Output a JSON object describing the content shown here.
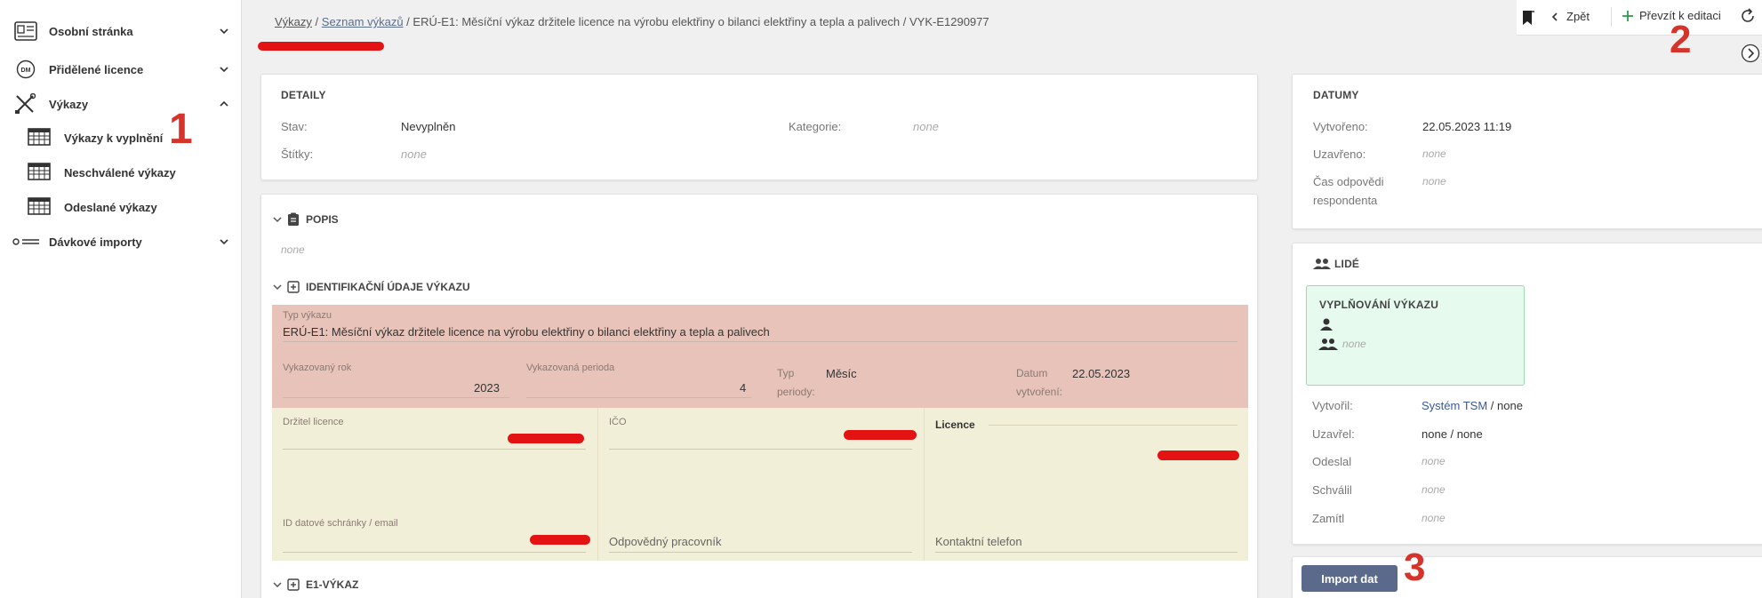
{
  "sidebar": {
    "items": [
      {
        "label": "Osobní stránka"
      },
      {
        "label": "Přidělené licence"
      },
      {
        "label": "Výkazy"
      },
      {
        "label": "Dávkové importy"
      }
    ],
    "subitems": [
      {
        "label": "Výkazy k vyplnění"
      },
      {
        "label": "Neschválené výkazy"
      },
      {
        "label": "Odeslané výkazy"
      }
    ]
  },
  "annotations": [
    "1",
    "2",
    "3"
  ],
  "breadcrumb": {
    "items": [
      "Výkazy",
      "Seznam výkazů",
      "ERÚ-E1: Měsíční výkaz držitele licence na výrobu elektřiny o bilanci elektřiny a tepla a palivech",
      "VYK-E1290977"
    ],
    "sep": "/"
  },
  "toolbar": {
    "back_label": "Zpět",
    "take_label": "Převzít k editaci"
  },
  "detail": {
    "title": "DETAILY",
    "state_key": "Stav:",
    "state_val": "Nevyplněn",
    "category_key": "Kategorie:",
    "category_val": "none",
    "tags_key": "Štítky:",
    "tags_val": "none"
  },
  "popis": {
    "title": "POPIS",
    "value": "none"
  },
  "ident": {
    "title": "IDENTIFIKAČNÍ ÚDAJE VÝKAZU",
    "type_label": "Typ výkazu",
    "type_value": "ERÚ-E1: Měsíční výkaz držitele licence na výrobu elektřiny o bilanci elektřiny a tepla a palivech",
    "year_label": "Vykazovaný rok",
    "year_value": "2023",
    "period_label": "Vykazovaná perioda",
    "period_value": "4",
    "ptype_label1": "Typ",
    "ptype_label2": "periody:",
    "ptype_value": "Měsíc",
    "date_label1": "Datum",
    "date_label2": "vytvoření:",
    "date_value": "22.05.2023",
    "holder_label": "Držitel licence",
    "ico_label": "IČO",
    "licence_label": "Licence",
    "ds_label": "ID datové schránky / email",
    "resp_label": "Odpovědný pracovník",
    "phone_label": "Kontaktní telefon"
  },
  "e1": {
    "title": "E1-VÝKAZ"
  },
  "dates": {
    "title": "DATUMY",
    "created_key": "Vytvořeno:",
    "created_val": "22.05.2023 11:19",
    "closed_key": "Uzavřeno:",
    "closed_val": "none",
    "resp_key1": "Čas odpovědi",
    "resp_key2": "respondenta",
    "resp_val": "none"
  },
  "people": {
    "title": "LIDÉ",
    "box_title": "VYPLŇOVÁNÍ VÝKAZU",
    "box_none": "none",
    "created_by_key": "Vytvořil:",
    "created_by_link": "Systém TSM",
    "created_by_rest": " / none",
    "closed_by_key": "Uzavřel:",
    "closed_by_val": "none / none",
    "sent_key": "Odeslal",
    "sent_val": "none",
    "approved_key": "Schválil",
    "approved_val": "none",
    "rejected_key": "Zamítl",
    "rejected_val": "none"
  },
  "import_label": "Import dat",
  "colors": {
    "accent": "#5b6a8a",
    "annotation": "#d6342a",
    "pink_section": "#e8c3b9",
    "beige_section": "#f2efd9",
    "green_box": "#e6fbee",
    "plus_green": "#2e9b4e"
  }
}
